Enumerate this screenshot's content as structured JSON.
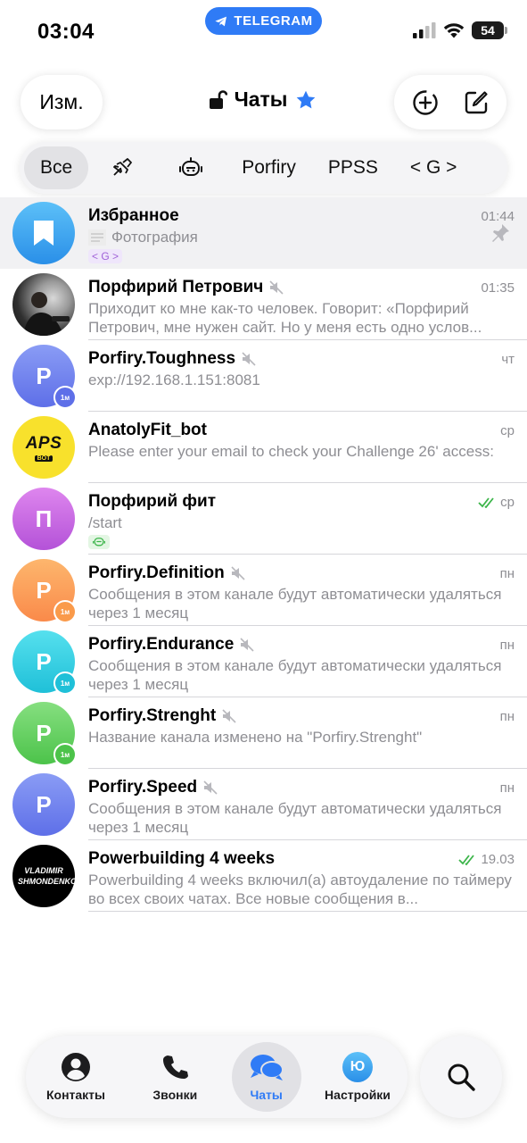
{
  "status_bar": {
    "time": "03:04",
    "app_pill": "TELEGRAM",
    "battery": "54"
  },
  "header": {
    "edit_label": "Изм.",
    "title": "Чаты"
  },
  "folders": [
    {
      "label": "Все",
      "type": "text",
      "active": true
    },
    {
      "label": "",
      "type": "icon",
      "icon": "airplane-icon"
    },
    {
      "label": "",
      "type": "icon",
      "icon": "robot-icon"
    },
    {
      "label": "Porfiry",
      "type": "text"
    },
    {
      "label": "PPSS",
      "type": "text"
    },
    {
      "label": "< G >",
      "type": "text"
    }
  ],
  "chats": [
    {
      "name": "Избранное",
      "time": "01:44",
      "message": "Фотография",
      "tag": "< G >",
      "pinned": true,
      "avatar_color": "#39a2f0",
      "avatar_icon": "bookmark-icon"
    },
    {
      "name": "Порфирий Петрович",
      "time": "01:35",
      "message": "Приходит ко мне как-то человек. Говорит: «Порфирий Петрович, мне нужен сайт. Но у меня есть одно услов...",
      "muted": true,
      "avatar_color": "#2a2a2a",
      "avatar_icon": "photo-avatar"
    },
    {
      "name": "Porfiry.Toughness",
      "time": "чт",
      "message": "exp://192.168.1.151:8081",
      "muted": true,
      "avatar_letter": "P",
      "avatar_color": "#6f86f0"
    },
    {
      "name": "AnatolyFit_bot",
      "time": "ср",
      "message": "Please enter your email to check your Challenge 26' access:",
      "avatar_color": "#f8e12c",
      "avatar_text": "APS",
      "avatar_subtext": "BOT"
    },
    {
      "name": "Порфирий фит",
      "time": "ср",
      "message": "/start",
      "read": true,
      "tag_icon": "robot-icon",
      "avatar_letter": "П",
      "avatar_color": "#c66ae0"
    },
    {
      "name": "Porfiry.Definition",
      "time": "пн",
      "message": "Сообщения в этом канале будут автоматически удаляться через 1 месяц",
      "muted": true,
      "avatar_letter": "P",
      "avatar_color": "#fb9d59"
    },
    {
      "name": "Porfiry.Endurance",
      "time": "пн",
      "message": "Сообщения в этом канале будут автоматически удаляться через 1 месяц",
      "muted": true,
      "avatar_letter": "P",
      "avatar_color": "#2fcfe0"
    },
    {
      "name": "Porfiry.Strenght",
      "time": "пн",
      "message": "Название канала изменено на \"Porfiry.Strenght\"",
      "muted": true,
      "avatar_letter": "P",
      "avatar_color": "#6fd36c"
    },
    {
      "name": "Porfiry.Speed",
      "time": "пн",
      "message": "Сообщения в этом канале будут автоматически удаляться через 1 месяц",
      "muted": true,
      "avatar_letter": "P",
      "avatar_color": "#6f86f0"
    },
    {
      "name": "Powerbuilding 4 weeks",
      "time": "19.03",
      "message": "Powerbuilding 4 weeks включил(а) автоудаление по таймеру во всех своих чатах. Все новые сообщения в...",
      "read": true,
      "avatar_color": "#000000",
      "avatar_text": "VLADIMIR SHMONDENKO"
    }
  ],
  "tabbar": [
    {
      "label": "Контакты",
      "icon": "person-icon"
    },
    {
      "label": "Звонки",
      "icon": "phone-icon"
    },
    {
      "label": "Чаты",
      "icon": "chat-bubbles-icon",
      "active": true
    },
    {
      "label": "Настройки",
      "icon": "profile-avatar-icon",
      "avatar_text": "Ю"
    }
  ],
  "colors": {
    "accent": "#2f7bf6",
    "read_check": "#3cb54a",
    "secondary_text": "#8e8e93"
  }
}
